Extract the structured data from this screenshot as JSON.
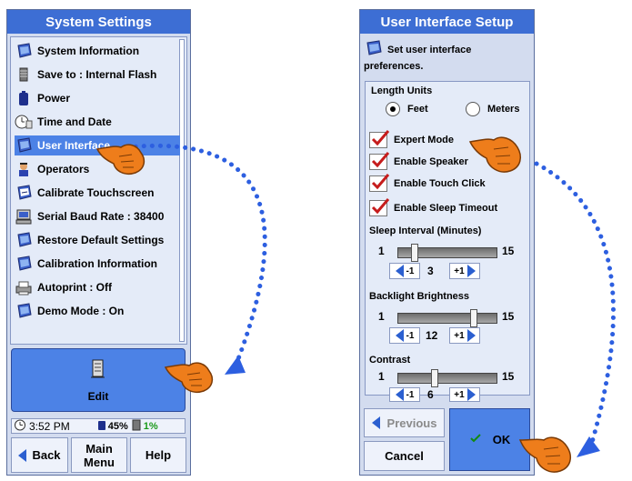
{
  "left": {
    "title": "System Settings",
    "items": [
      {
        "label": "System Information",
        "icon": "handheld-icon"
      },
      {
        "label": "Save to : Internal Flash",
        "icon": "memory-card-icon"
      },
      {
        "label": "Power",
        "icon": "battery-icon"
      },
      {
        "label": "Time and Date",
        "icon": "clock-icon"
      },
      {
        "label": "User Interface",
        "icon": "handheld-icon"
      },
      {
        "label": "Operators",
        "icon": "operator-icon"
      },
      {
        "label": "Calibrate Touchscreen",
        "icon": "touchscreen-icon"
      },
      {
        "label": "Serial Baud Rate : 38400",
        "icon": "computer-icon"
      },
      {
        "label": "Restore Default Settings",
        "icon": "handheld-icon"
      },
      {
        "label": "Calibration Information",
        "icon": "handheld-icon"
      },
      {
        "label": "Autoprint : Off",
        "icon": "printer-icon"
      },
      {
        "label": "Demo Mode : On",
        "icon": "handheld-icon"
      }
    ],
    "selected_index": 4,
    "edit_label": "Edit",
    "status": {
      "time": "3:52 PM",
      "battery": "45%",
      "memory": "1%"
    },
    "nav": {
      "back": "Back",
      "main_menu": "Main Menu",
      "help": "Help"
    }
  },
  "right": {
    "title": "User Interface Setup",
    "intro": "Set user interface preferences.",
    "length_units_label": "Length Units",
    "unit_feet": "Feet",
    "unit_meters": "Meters",
    "selected_unit": "Feet",
    "checkboxes": [
      {
        "label": "Expert Mode",
        "checked": true
      },
      {
        "label": "Enable Speaker",
        "checked": true
      },
      {
        "label": "Enable Touch Click",
        "checked": true
      },
      {
        "label": "Enable Sleep Timeout",
        "checked": true
      }
    ],
    "sleep": {
      "label": "Sleep Interval (Minutes)",
      "min": "1",
      "max": "15",
      "value": "3",
      "fraction": 0.14
    },
    "backlight": {
      "label": "Backlight Brightness",
      "min": "1",
      "max": "15",
      "value": "12",
      "fraction": 0.79
    },
    "contrast": {
      "label": "Contrast",
      "min": "1",
      "max": "15",
      "value": "6",
      "fraction": 0.36
    },
    "dec_label": "-1",
    "inc_label": "+1",
    "previous_label": "Previous",
    "cancel_label": "Cancel",
    "ok_label": "OK"
  },
  "colors": {
    "accent": "#3d6ed4",
    "selection": "#4c82e6",
    "panel": "#d3dcef",
    "arrow": "#2d5fe0",
    "hand": "#ee7d1b"
  }
}
